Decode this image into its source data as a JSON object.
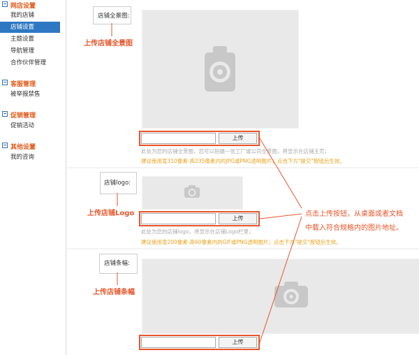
{
  "sidebar": {
    "sections": [
      {
        "title": "网店设置",
        "items": [
          "我的店铺",
          "店铺设置",
          "主题设置",
          "导航管理",
          "合作伙伴管理"
        ]
      },
      {
        "title": "客服管理",
        "items": [
          "被举报禁售"
        ]
      },
      {
        "title": "促销管理",
        "items": [
          "促销活动"
        ]
      },
      {
        "title": "其他设置",
        "items": [
          "我的咨询"
        ]
      }
    ],
    "active_item": "店铺设置"
  },
  "panorama": {
    "label": "店铺全景图:",
    "annotation": "上传店铺全景图",
    "button": "上传",
    "input_value": "",
    "hint1": "此处为您的店铺全景图，您可以拍摄一张工厂或公司全景图，将显示在店铺主页；",
    "hint2": "建议使用宽310像素-高235像素内的JPG或PNG透明图片；点击下方\"提交\"按钮后生效。"
  },
  "logo": {
    "label": "店铺logo:",
    "annotation": "上传店铺Logo",
    "button": "上传",
    "input_value": "",
    "hint1": "此处为您的店铺logo，将显示在店铺Logo栏里；",
    "hint2": "建议使用宽200像素-高60像素内的GIF或PNG透明图片；点击下方\"提交\"按钮后生效。"
  },
  "banner": {
    "label": "店铺条幅:",
    "annotation": "上传店铺条幅",
    "button": "上传",
    "input_value": ""
  },
  "callout": {
    "line1": "点击上传按钮，从桌面或者文档",
    "line2": "中载入符合规格内的图片地址。"
  },
  "colors": {
    "accent": "#e8552a",
    "sidebar_active": "#2e78c3",
    "section_title": "#e25b1c",
    "hint_orange": "#e8a21c"
  }
}
